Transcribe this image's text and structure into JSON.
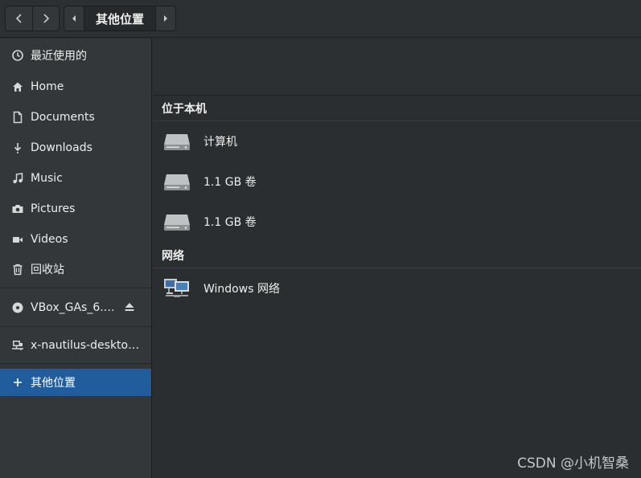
{
  "header": {
    "back_icon": "chevron-left-icon",
    "forward_icon": "chevron-right-icon",
    "path_current": "其他位置"
  },
  "sidebar": {
    "items": [
      {
        "label": "最近使用的",
        "icon": "clock-icon"
      },
      {
        "label": "Home",
        "icon": "home-icon"
      },
      {
        "label": "Documents",
        "icon": "document-icon"
      },
      {
        "label": "Downloads",
        "icon": "download-icon"
      },
      {
        "label": "Music",
        "icon": "music-icon"
      },
      {
        "label": "Pictures",
        "icon": "camera-icon"
      },
      {
        "label": "Videos",
        "icon": "video-icon"
      },
      {
        "label": "回收站",
        "icon": "trash-icon"
      }
    ],
    "devices": [
      {
        "label": "VBox_GAs_6.…",
        "icon": "disc-icon",
        "eject_icon": "eject-icon"
      }
    ],
    "network": [
      {
        "label": "x-nautilus-deskto…",
        "icon": "network-icon"
      }
    ],
    "other_locations": {
      "label": "其他位置",
      "icon": "plus-icon"
    }
  },
  "main": {
    "local_section": {
      "title": "位于本机",
      "rows": [
        {
          "label": "计算机",
          "icon": "drive-icon"
        },
        {
          "label": "1.1 GB 卷",
          "icon": "drive-icon"
        },
        {
          "label": "1.1 GB 卷",
          "icon": "drive-icon"
        }
      ]
    },
    "network_section": {
      "title": "网络",
      "rows": [
        {
          "label": "Windows 网络",
          "icon": "network-computers-icon"
        }
      ]
    }
  },
  "watermark": "CSDN @小机智桑",
  "colors": {
    "sidebar_bg": "#33373a",
    "main_bg": "#2b2e31",
    "selected": "#215d9c"
  }
}
